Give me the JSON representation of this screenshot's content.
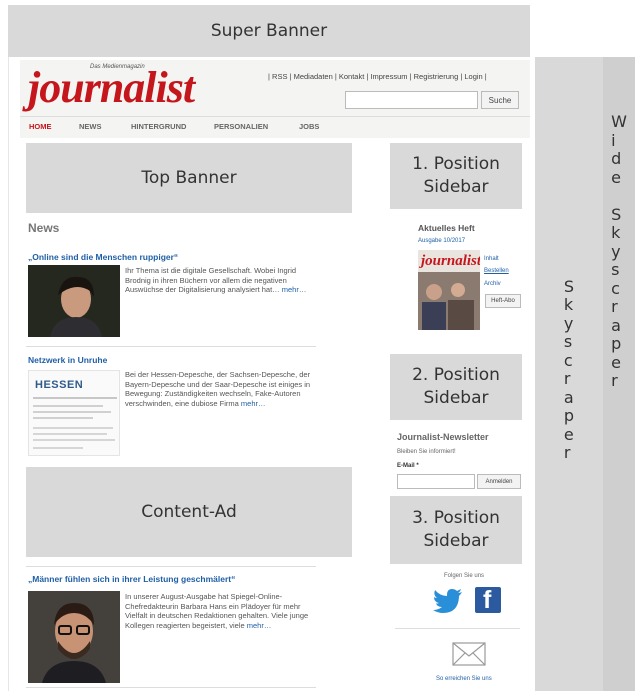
{
  "ad_slots": {
    "super_banner": "Super Banner",
    "top_banner": "Top Banner",
    "content_ad": "Content-Ad",
    "sidebar_1": [
      "1. Position",
      "Sidebar"
    ],
    "sidebar_2": [
      "2. Position",
      "Sidebar"
    ],
    "sidebar_3": [
      "3. Position",
      "Sidebar"
    ],
    "skyscraper": [
      "S",
      "k",
      "y",
      "s",
      "c",
      "r",
      "a",
      "p",
      "e",
      "r"
    ],
    "wide_skyscraper": [
      "W",
      "i",
      "d",
      "e",
      "",
      "S",
      "k",
      "y",
      "s",
      "c",
      "r",
      "a",
      "p",
      "e",
      "r"
    ]
  },
  "header": {
    "kicker": "Das Medienmagazin",
    "logo": "journalist",
    "top_links": "| RSS | Mediadaten | Kontakt | Impressum | Registrierung | Login |",
    "search_button": "Suche"
  },
  "nav": [
    "HOME",
    "NEWS",
    "HINTERGRUND",
    "PERSONALIEN",
    "JOBS"
  ],
  "news": {
    "section_title": "News",
    "items": [
      {
        "title": "„Online sind die Menschen ruppiger“",
        "text": "Ihr Thema ist die digitale Gesellschaft. Wobei Ingrid Brodnig in ihren Büchern vor allem die negativen Auswüchse der Digitalisierung analysiert hat…",
        "more": "mehr…"
      },
      {
        "title": "Netzwerk in Unruhe",
        "text": "Bei der Hessen-Depesche, der Sachsen-Depesche, der Bayern-Depesche und der Saar-Depesche ist einiges in Bewegung: Zuständigkeiten wechseln, Fake-Autoren verschwinden, eine dubiose Firma",
        "more": "mehr…",
        "thumb_label": "HESSEN"
      },
      {
        "title": "„Männer fühlen sich in ihrer Leistung geschmälert“",
        "text": "In unserer August-Ausgabe hat Spiegel-Online-Chefredakteurin Barbara Hans ein Plädoyer für mehr Vielfalt in deutschen Redaktionen gehalten. Viele junge Kollegen reagierten begeistert, viele",
        "more": "mehr…"
      }
    ]
  },
  "sidebar": {
    "issue_title": "Aktuelles Heft",
    "issue_label": "Ausgabe 10/2017",
    "issue_links": [
      "Inhalt",
      "Bestellen",
      "Archiv"
    ],
    "issue_button": "Heft-Abo",
    "cover_logo": "journalist",
    "newsletter_title": "Journalist-Newsletter",
    "newsletter_sub": "Bleiben Sie informiert!",
    "email_label": "E-Mail *",
    "newsletter_button": "Anmelden",
    "follow_label": "Folgen Sie uns",
    "contact_label": "So erreichen Sie uns"
  },
  "colors": {
    "brand_red": "#c4161c",
    "link_blue": "#1f5fa6",
    "ad_grey": "#d9d9d9"
  }
}
